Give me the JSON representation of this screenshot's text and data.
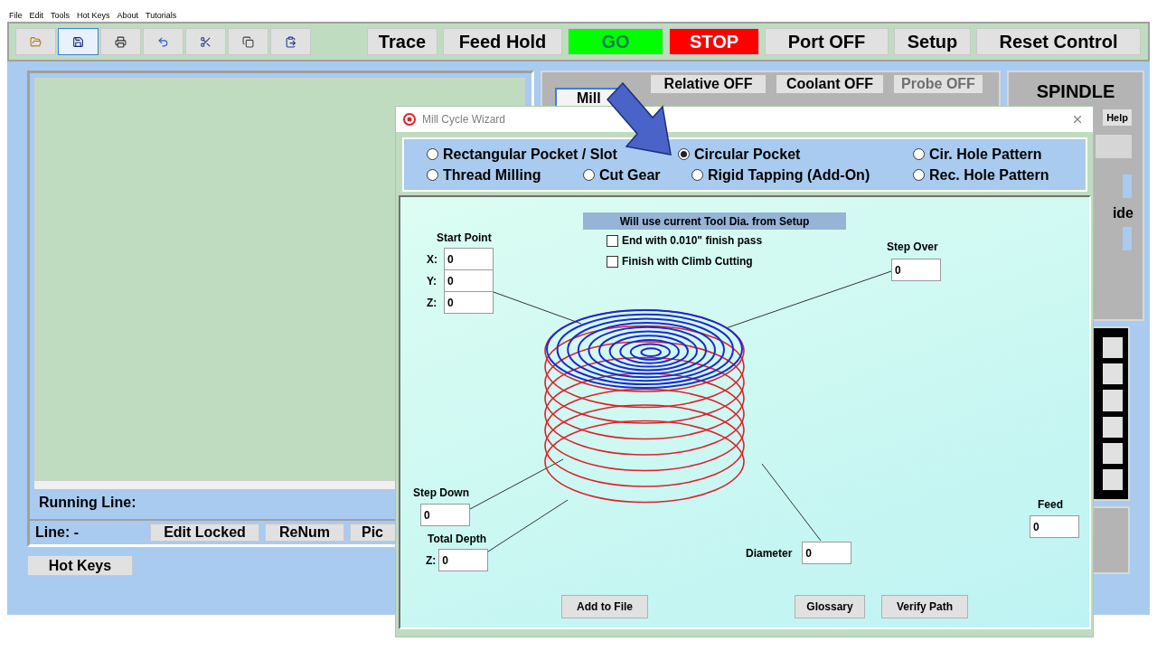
{
  "menu": [
    "File",
    "Edit",
    "Tools",
    "Hot Keys",
    "About",
    "Tutorials"
  ],
  "toolbar": {
    "icons": [
      {
        "selected": false
      },
      {
        "selected": true
      },
      {
        "selected": false
      },
      {
        "selected": false
      },
      {
        "selected": false
      },
      {
        "selected": false
      },
      {
        "selected": false
      }
    ],
    "buttons": [
      {
        "label": "Trace",
        "kind": "plain"
      },
      {
        "label": "Feed Hold",
        "kind": "plain"
      },
      {
        "label": "GO",
        "kind": "go"
      },
      {
        "label": "STOP",
        "kind": "stop"
      },
      {
        "label": "Port OFF",
        "kind": "plain"
      },
      {
        "label": "Setup",
        "kind": "plain"
      },
      {
        "label": "Reset Control",
        "kind": "plain"
      }
    ]
  },
  "program_panel": {
    "running_line_label": "Running Line:",
    "line_label": "Line: -",
    "buttons": [
      "Edit Locked",
      "ReNum",
      "Pic"
    ]
  },
  "hot_keys_button": "Hot Keys",
  "machine_panel": {
    "mode_button": "Mill",
    "toggles": [
      {
        "label": "Relative OFF",
        "disabled": false
      },
      {
        "label": "Coolant OFF",
        "disabled": false
      },
      {
        "label": "Probe OFF",
        "disabled": true
      }
    ]
  },
  "spindle_panel": {
    "title": "SPINDLE",
    "help_button": "Help",
    "label_fragment": "ide"
  },
  "dialog": {
    "title": "Mill Cycle Wizard",
    "operation_rows": [
      [
        {
          "label": "Rectangular Pocket / Slot",
          "selected": false
        },
        {
          "label": "Circular Pocket",
          "selected": true
        },
        {
          "label": "Cir. Hole Pattern",
          "selected": false
        }
      ],
      [
        {
          "label": "Thread Milling",
          "selected": false
        },
        {
          "label": "Cut Gear",
          "selected": false
        },
        {
          "label": "Rigid Tapping (Add-On)",
          "selected": false
        },
        {
          "label": "Rec. Hole Pattern",
          "selected": false
        }
      ]
    ],
    "note": "Will use current Tool Dia. from Setup",
    "options": [
      {
        "label": "End with 0.010\" finish pass",
        "checked": false
      },
      {
        "label": "Finish with Climb Cutting",
        "checked": false
      }
    ],
    "start_point": {
      "label": "Start Point",
      "fields": [
        {
          "label": "X:",
          "value": "0"
        },
        {
          "label": "Y:",
          "value": "0"
        },
        {
          "label": "Z:",
          "value": "0"
        }
      ]
    },
    "step_over": {
      "label": "Step Over",
      "value": "0"
    },
    "step_down": {
      "label": "Step Down",
      "value": "0"
    },
    "total_depth": {
      "label": "Total Depth",
      "field_label": "Z:",
      "value": "0"
    },
    "diameter": {
      "label": "Diameter",
      "value": "0"
    },
    "feed": {
      "label": "Feed",
      "value": "0"
    },
    "buttons": [
      "Add to File",
      "Glossary",
      "Verify Path"
    ]
  }
}
